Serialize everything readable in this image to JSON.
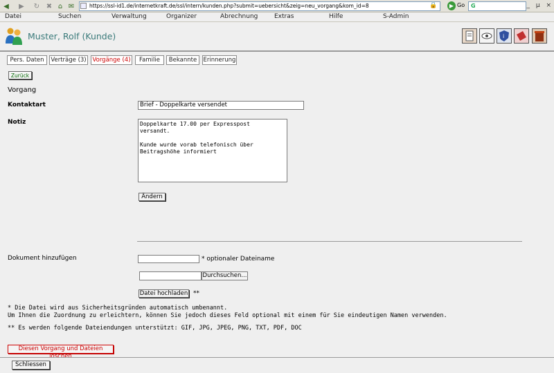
{
  "browser": {
    "url": "https://ssl-id1.de/internetkraft.de/ssl/intern/kunden.php?submit=uebersicht&zeig=neu_vorgang&kom_id=8",
    "go_label": "Go",
    "search_value": "G",
    "window_controls": [
      "_",
      "µ",
      "×"
    ]
  },
  "menu": [
    "Datei",
    "Suchen",
    "Verwaltung",
    "Organizer",
    "Abrechnung",
    "Extras",
    "Hilfe",
    "S-Admin"
  ],
  "header": {
    "customer_name": "Muster, Rolf (Kunde)",
    "tools": [
      "print-icon",
      "eye-icon",
      "shield-icon",
      "note-icon",
      "trash-icon"
    ]
  },
  "tabs": [
    "Pers. Daten",
    "Verträge (3)",
    "Vorgänge (4)",
    "Familie",
    "Bekannte",
    "Erinnerung"
  ],
  "active_tab": "Vorgänge (4)",
  "form": {
    "back_label": "Zurück",
    "section_title": "Vorgang",
    "kontaktart_label": "Kontaktart",
    "kontaktart_value": "Brief - Doppelkarte versendet",
    "notiz_label": "Notiz",
    "notiz_value": "Doppelkarte 17.00 per Expresspost\nversandt.\n\nKunde wurde vorab telefonisch über\nBeitragshöhe informiert",
    "aendern_label": "Ändern",
    "dokument_label": "Dokument hinzufügen",
    "optional_hint": "* optionaler Dateiname",
    "browse_label": "Durchsuchen...",
    "upload_label": "Datei hochladen",
    "upload_marker": "**",
    "note1": "* Die Datei wird aus Sicherheitsgründen automatisch umbenannt.",
    "note2": "Um Ihnen die Zuordnung zu erleichtern, können Sie jedoch dieses Feld optional mit einem für Sie eindeutigen Namen verwenden.",
    "note3": "** Es werden folgende Dateiendungen unterstützt: GIF, JPG, JPEG, PNG, TXT, PDF, DOC",
    "delete_label": "Diesen Vorgang und Dateien löschen",
    "close_label": "Schliessen"
  },
  "colors": {
    "active_tab_text": "#cc0000",
    "name_text": "#3a7a7a",
    "delete_text": "#cc0000",
    "back_text": "#006600"
  }
}
